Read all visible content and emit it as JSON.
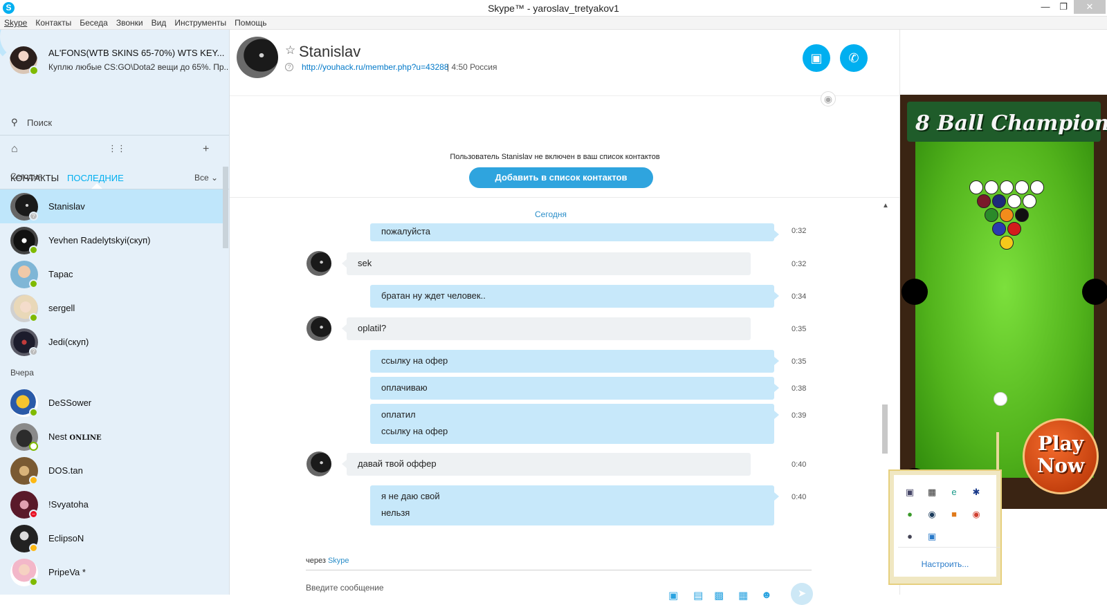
{
  "window": {
    "title": "Skype™ - yaroslav_tretyakov1",
    "logo_glyph": "S"
  },
  "menu": [
    "Skype",
    "Контакты",
    "Беседа",
    "Звонки",
    "Вид",
    "Инструменты",
    "Помощь"
  ],
  "profile": {
    "name": "AL'FONS(WTB SKINS 65-70%) WTS KEY...",
    "mood": "Куплю любые CS:GO\\Dota2 вещи до 65%. Пр...",
    "status": "online"
  },
  "search": {
    "label": "Поиск"
  },
  "tabs": {
    "contacts": "КОНТАКТЫ",
    "recent": "ПОСЛЕДНИЕ",
    "filter": "Все"
  },
  "sections": {
    "today": "Сегодня",
    "yesterday": "Вчера"
  },
  "contacts": [
    {
      "name": "Stanislav",
      "status": "unknown",
      "selected": true
    },
    {
      "name": "Yevhen Radelytskyi(скуп)",
      "status": "online"
    },
    {
      "name": "Тарас",
      "status": "online"
    },
    {
      "name": "sergell",
      "status": "online"
    },
    {
      "name": "Jedi(скуп)",
      "status": "unknown"
    },
    {
      "name": "DeSSower",
      "status": "online"
    },
    {
      "name": "Nest",
      "status": "offline",
      "suffix": "ONLINE"
    },
    {
      "name": "DOS.tan",
      "status": "away"
    },
    {
      "name": "!Svyatoha",
      "status": "busy"
    },
    {
      "name": "EclipsoN",
      "status": "away"
    },
    {
      "name": "PripeVa *",
      "status": "online"
    }
  ],
  "chat": {
    "name": "Stanislav",
    "link": "http://youhack.ru/member.php?u=43288",
    "meta": "|  4:50 Россия",
    "notice": "Пользователь Stanislav не включен в ваш список контактов",
    "add_button": "Добавить в список контактов",
    "day_label": "Сегодня",
    "messages": [
      {
        "dir": "out",
        "lines": [
          "пожалуйста"
        ],
        "time": "0:32"
      },
      {
        "dir": "in",
        "lines": [
          "sek"
        ],
        "time": "0:32"
      },
      {
        "dir": "out",
        "lines": [
          "братан ну ждет человек.."
        ],
        "time": "0:34"
      },
      {
        "dir": "in",
        "lines": [
          "oplatil?"
        ],
        "time": "0:35"
      },
      {
        "dir": "out",
        "lines": [
          "ссылку на офер"
        ],
        "time": "0:35"
      },
      {
        "dir": "out",
        "lines": [
          "оплачиваю"
        ],
        "time": "0:38"
      },
      {
        "dir": "out",
        "lines": [
          "оплатил",
          "ссылку на офер"
        ],
        "time": "0:39"
      },
      {
        "dir": "in",
        "lines": [
          "давай твой оффер"
        ],
        "time": "0:40"
      },
      {
        "dir": "out",
        "lines": [
          "я не даю свой",
          "нельзя"
        ],
        "time": "0:40"
      }
    ],
    "via_prefix": "через",
    "via_app": "Skype",
    "compose_placeholder": "Введите сообщение"
  },
  "ad": {
    "title": "8 Ball Champion",
    "cta_line1": "Play",
    "cta_line2": "Now"
  },
  "tray": {
    "configure": "Настроить..."
  },
  "colors": {
    "accent": "#00aff0",
    "online": "#7fba00",
    "away": "#fdb813",
    "busy": "#e81123"
  },
  "icons": {
    "call": [
      "video-call-icon",
      "voice-call-icon"
    ],
    "compose": [
      "send-photo-icon",
      "send-file-icon",
      "video-message-icon",
      "send-contact-icon",
      "emoticon-icon",
      "send-icon"
    ],
    "tray": [
      "monitor-icon",
      "network-icon",
      "antivirus-icon",
      "bluetooth-icon",
      "evernote-icon",
      "steam-icon",
      "app-icon",
      "chrome-icon",
      "lock-icon",
      "display-icon"
    ]
  }
}
